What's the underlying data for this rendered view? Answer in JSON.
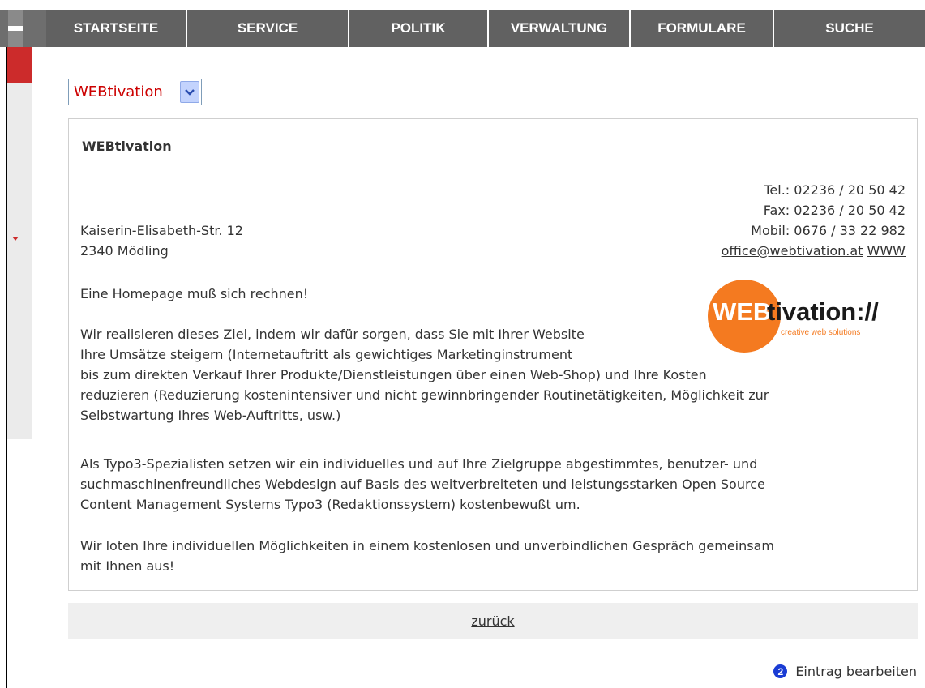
{
  "nav": {
    "items": [
      {
        "label": "STARTSEITE",
        "width": 174
      },
      {
        "label": "SERVICE",
        "width": 200
      },
      {
        "label": "POLITIK",
        "width": 172
      },
      {
        "label": "VERWALTUNG",
        "width": 175
      },
      {
        "label": "FORMULARE",
        "width": 177
      },
      {
        "label": "SUCHE",
        "width": 186
      }
    ]
  },
  "select": {
    "value": "WEBtivation"
  },
  "entry": {
    "title": "WEBtivation",
    "address": [
      "Kaiserin-Elisabeth-Str. 12",
      "2340 Mödling"
    ],
    "contact": {
      "tel": "Tel.: 02236 / 20 50 42",
      "fax": "Fax: 02236 / 20 50 42",
      "mobil": "Mobil: 0676 / 33 22 982",
      "email": "office@webtivation.at",
      "www": "WWW"
    },
    "logo": {
      "web": "WEB",
      "tivation": "tivation://",
      "tagline": "creative web solutions"
    },
    "paragraphs": [
      "Eine Homepage muß sich rechnen!",
      "Wir realisieren dieses Ziel, indem wir dafür sorgen, dass Sie mit Ihrer Website",
      "Ihre Umsätze steigern (Internetauftritt als gewichtiges Marketinginstrument",
      "bis zum direkten Verkauf Ihrer Produkte/Dienstleistungen über einen Web-Shop) und Ihre Kosten",
      "reduzieren (Reduzierung kostenintensiver und nicht gewinnbringender Routinetätigkeiten, Möglichkeit zur",
      "Selbstwartung Ihres Web-Auftritts, usw.)",
      "Als Typo3-Spezialisten setzen wir ein individuelles und auf Ihre Zielgruppe abgestimmtes, benutzer- und",
      "suchmaschinenfreundliches Webdesign auf Basis des weitverbreiteten und leistungsstarken Open Source",
      "Content Management Systems Typo3 (Redaktionssystem) kostenbewußt um.",
      "Wir loten Ihre individuellen Möglichkeiten in einem kostenlosen und unverbindlichen Gespräch gemeinsam",
      "mit Ihnen aus!"
    ]
  },
  "back": {
    "label": "zurück"
  },
  "edit": {
    "icon_text": "2",
    "label": "Eintrag bearbeiten"
  },
  "colors": {
    "nav_bg": "#616161",
    "accent_red": "#cc2b2b",
    "logo_orange": "#f47a20",
    "edit_icon_blue": "#1a3cd4"
  }
}
